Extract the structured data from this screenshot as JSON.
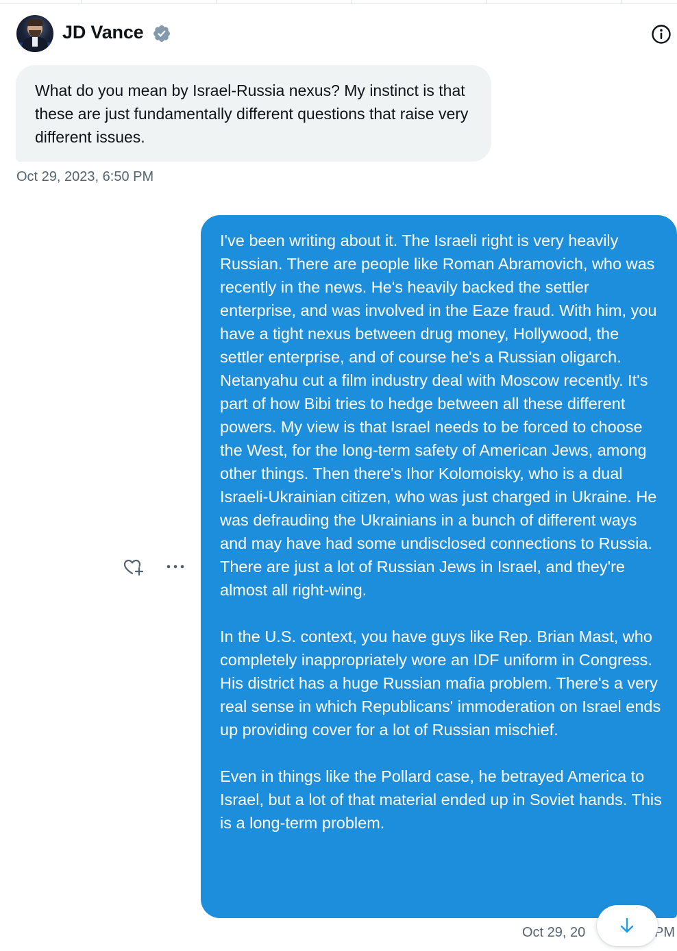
{
  "header": {
    "name": "JD Vance",
    "verified_icon": "verified-badge-icon",
    "info_icon": "info-icon"
  },
  "messages": [
    {
      "direction": "incoming",
      "text": "What do you mean by Israel-Russia nexus? My instinct is that these are just fundamentally different questions that raise very different issues.",
      "timestamp": "Oct 29, 2023, 6:50 PM"
    },
    {
      "direction": "outgoing",
      "paragraphs": [
        "I've been writing about it. The Israeli right is very heavily Russian. There are people like Roman Abramovich, who was recently in the news. He's heavily backed the settler enterprise, and was involved in the Eaze fraud. With him, you have a tight nexus between drug money, Hollywood, the settler enterprise, and of course he's a Russian oligarch. Netanyahu cut a film industry deal with Moscow recently. It's part of how Bibi tries to hedge between all these different powers. My view is that Israel needs to be forced to choose the West, for the long-term safety of American Jews, among other things. Then there's Ihor Kolomoisky, who is a dual Israeli-Ukrainian citizen, who was just charged in Ukraine. He was defrauding the Ukrainians in a bunch of different ways and may have had some undisclosed connections to Russia. There are just a lot of Russian Jews in Israel, and they're almost all right-wing.",
        "In the U.S. context, you have guys like Rep. Brian Mast, who completely inappropriately wore an IDF uniform in Congress. His district has a huge Russian mafia problem. There's a very real sense in which Republicans' immoderation on Israel ends up providing cover for a lot of Russian mischief.",
        "Even in things like the Pollard case, he betrayed America to Israel, but a lot of that material ended up in Soviet hands. This is a long-term problem."
      ],
      "timestamp_visible_start": "Oct 29, 20",
      "timestamp_visible_end": "PM"
    }
  ],
  "actions": {
    "react_icon": "heart-plus-icon",
    "more_icon": "more-horizontal-icon",
    "scroll_down_icon": "arrow-down-icon"
  },
  "colors": {
    "outgoing_bubble": "#1d8edb",
    "incoming_bubble": "#eff3f4",
    "timestamp": "#536471",
    "verified": "#829aab",
    "accent": "#1d9bf0"
  }
}
